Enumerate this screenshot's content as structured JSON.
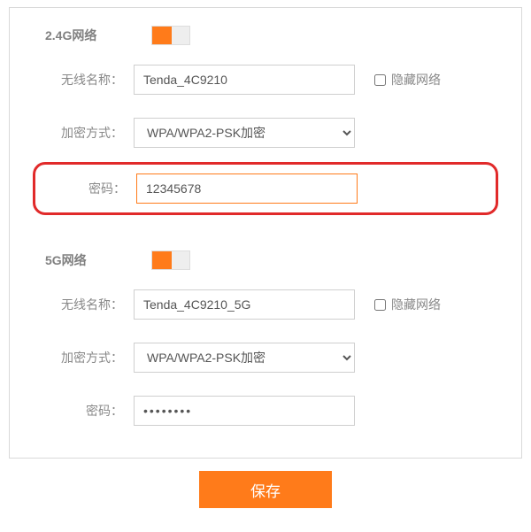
{
  "colors": {
    "accent": "#ff7b1a",
    "highlight": "#e12a2a"
  },
  "wifi24": {
    "title": "2.4G网络",
    "enabled": true,
    "ssid_label": "无线名称：",
    "ssid_value": "Tenda_4C9210",
    "hide_label": "隐藏网络",
    "hide_checked": false,
    "enc_label": "加密方式：",
    "enc_value": "WPA/WPA2-PSK加密",
    "pwd_label": "密码：",
    "pwd_value": "12345678"
  },
  "wifi5": {
    "title": "5G网络",
    "enabled": true,
    "ssid_label": "无线名称：",
    "ssid_value": "Tenda_4C9210_5G",
    "hide_label": "隐藏网络",
    "hide_checked": false,
    "enc_label": "加密方式：",
    "enc_value": "WPA/WPA2-PSK加密",
    "pwd_label": "密码：",
    "pwd_value": "••••••••"
  },
  "save_label": "保存"
}
